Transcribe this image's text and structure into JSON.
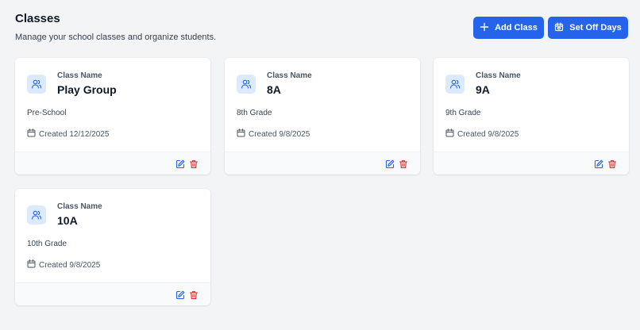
{
  "header": {
    "title": "Classes",
    "subtitle": "Manage your school classes and organize students.",
    "add_class_label": "Add Class",
    "set_off_days_label": "Set Off Days"
  },
  "colors": {
    "primary": "#2563eb",
    "icon_bg": "#dbeafe",
    "delete": "#dc2626",
    "background": "#f3f4f6"
  },
  "cards": [
    {
      "label": "Class Name",
      "name": "Play Group",
      "grade": "Pre-School",
      "created": "Created 12/12/2025"
    },
    {
      "label": "Class Name",
      "name": "8A",
      "grade": "8th Grade",
      "created": "Created 9/8/2025"
    },
    {
      "label": "Class Name",
      "name": "9A",
      "grade": "9th Grade",
      "created": "Created 9/8/2025"
    },
    {
      "label": "Class Name",
      "name": "10A",
      "grade": "10th Grade",
      "created": "Created 9/8/2025"
    }
  ]
}
